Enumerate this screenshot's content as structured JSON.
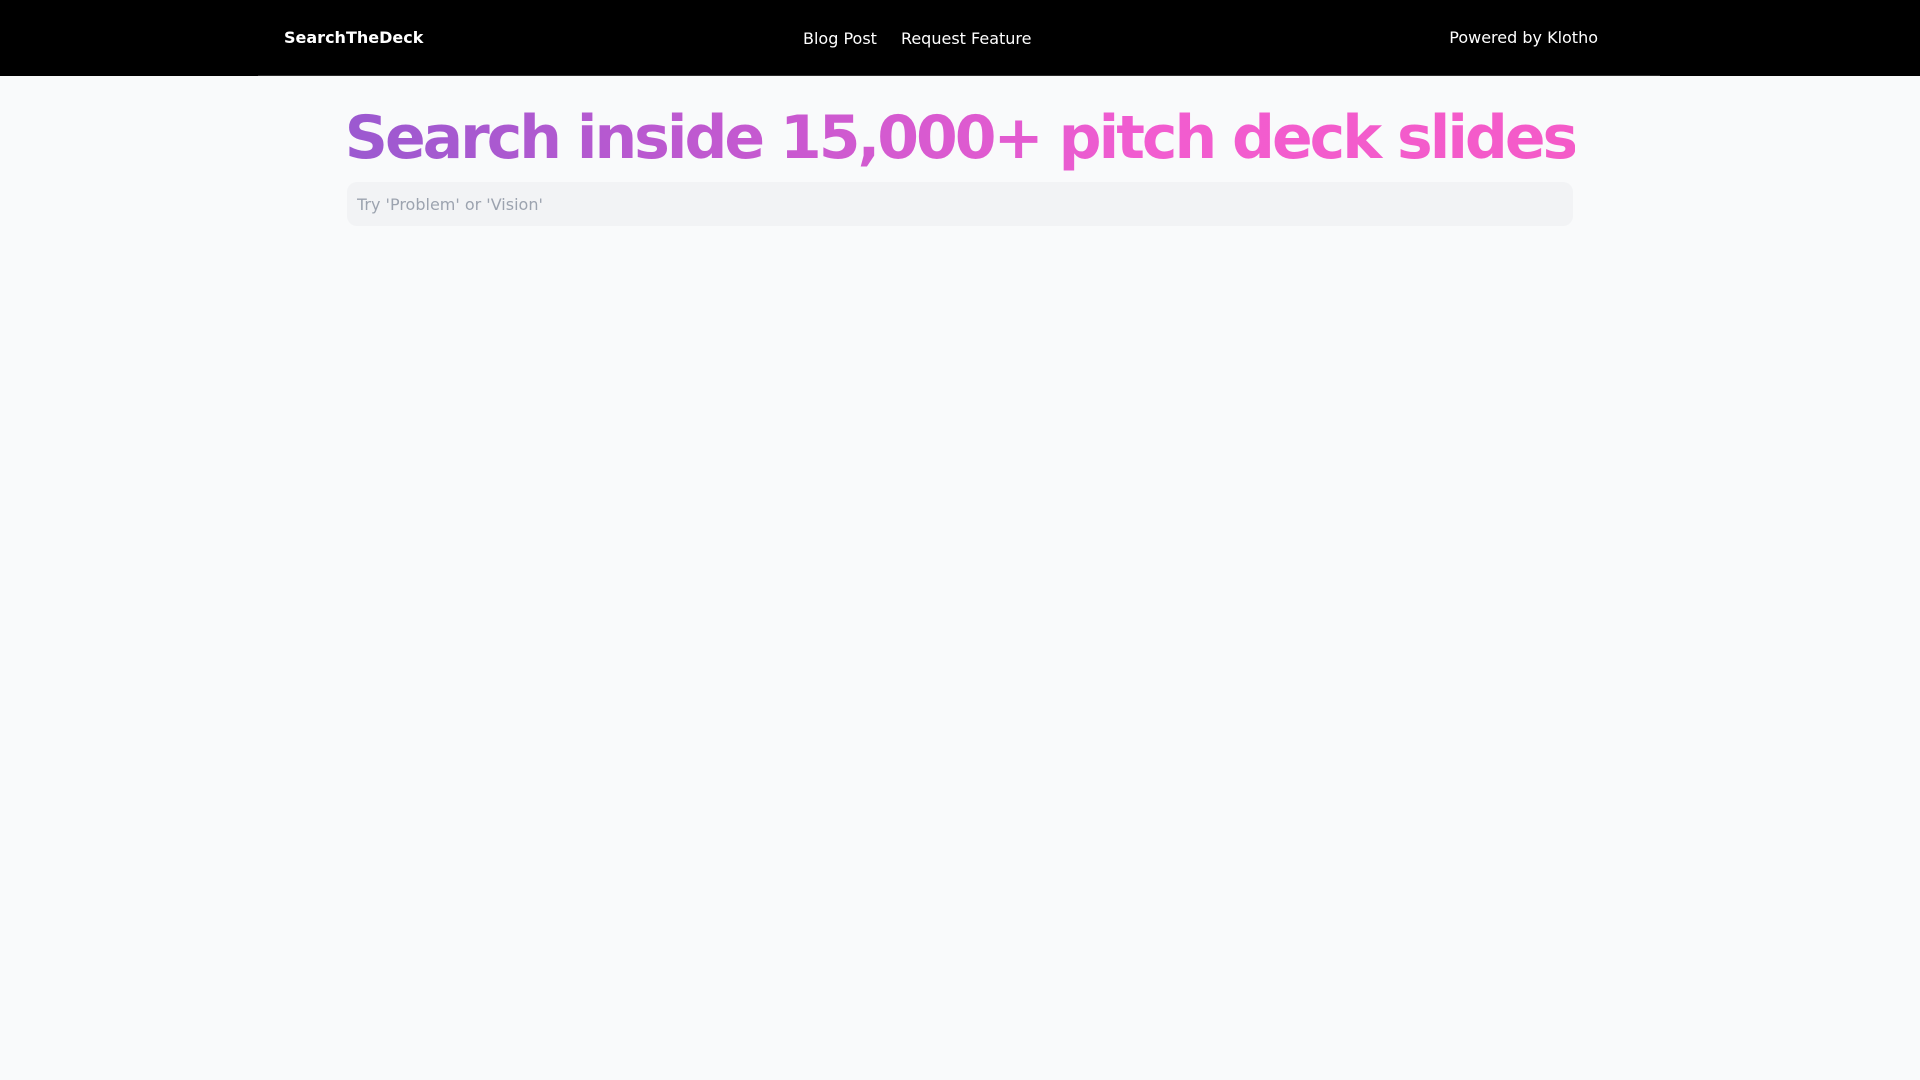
{
  "header": {
    "brand": "SearchTheDeck",
    "nav": {
      "blog_post": "Blog Post",
      "request_feature": "Request Feature"
    },
    "powered_by": "Powered by Klotho"
  },
  "hero": {
    "title": "Search inside 15,000+ pitch deck slides"
  },
  "search": {
    "placeholder": "Try 'Problem' or 'Vision'",
    "value": ""
  },
  "colors": {
    "header_bg": "#000000",
    "page_bg": "#f9fafb",
    "title_gradient_start": "#9b59d0",
    "title_gradient_end": "#f45bc8",
    "search_bg": "#f2f3f5"
  }
}
